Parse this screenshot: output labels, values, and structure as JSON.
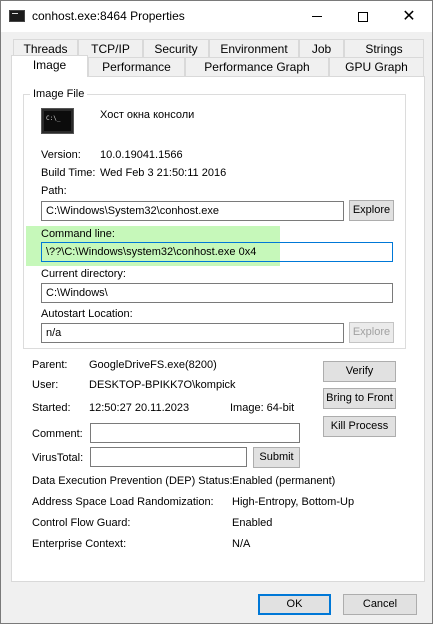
{
  "window": {
    "title": "conhost.exe:8464 Properties"
  },
  "tabs_row1": [
    "Threads",
    "TCP/IP",
    "Security",
    "Environment",
    "Job",
    "Strings"
  ],
  "tabs_row2": [
    "Image",
    "Performance",
    "Performance Graph",
    "GPU Graph"
  ],
  "active_tab": "Image",
  "image_file": {
    "group_label": "Image File",
    "description": "Хост окна консоли",
    "version_label": "Version:",
    "version_value": "10.0.19041.1566",
    "build_time_label": "Build Time:",
    "build_time_value": "Wed Feb  3 21:50:11 2016",
    "path_label": "Path:",
    "path_value": "C:\\Windows\\System32\\conhost.exe",
    "explore_label": "Explore",
    "command_line_label": "Command line:",
    "command_line_value": "\\??\\C:\\Windows\\system32\\conhost.exe 0x4",
    "current_dir_label": "Current directory:",
    "current_dir_value": "C:\\Windows\\",
    "autostart_label": "Autostart Location:",
    "autostart_value": "n/a",
    "explore_disabled_label": "Explore"
  },
  "process": {
    "parent_label": "Parent:",
    "parent_value": "GoogleDriveFS.exe(8200)",
    "user_label": "User:",
    "user_value": "DESKTOP-BPIKK7O\\kompick",
    "started_label": "Started:",
    "started_value": "12:50:27   20.11.2023",
    "image_bits": "Image: 64-bit",
    "verify_label": "Verify",
    "bring_front_label": "Bring to Front",
    "kill_label": "Kill Process",
    "comment_label": "Comment:",
    "comment_value": "",
    "virustotal_label": "VirusTotal:",
    "virustotal_value": "",
    "submit_label": "Submit"
  },
  "security_info": [
    {
      "label": "Data Execution Prevention (DEP) Status:",
      "value": "Enabled (permanent)"
    },
    {
      "label": "Address Space Load Randomization:",
      "value": "High-Entropy, Bottom-Up"
    },
    {
      "label": "Control Flow Guard:",
      "value": "Enabled"
    },
    {
      "label": "Enterprise Context:",
      "value": "N/A"
    }
  ],
  "footer": {
    "ok_label": "OK",
    "cancel_label": "Cancel"
  },
  "colors": {
    "highlight": "#b3f5a3",
    "accent": "#0078d7"
  }
}
